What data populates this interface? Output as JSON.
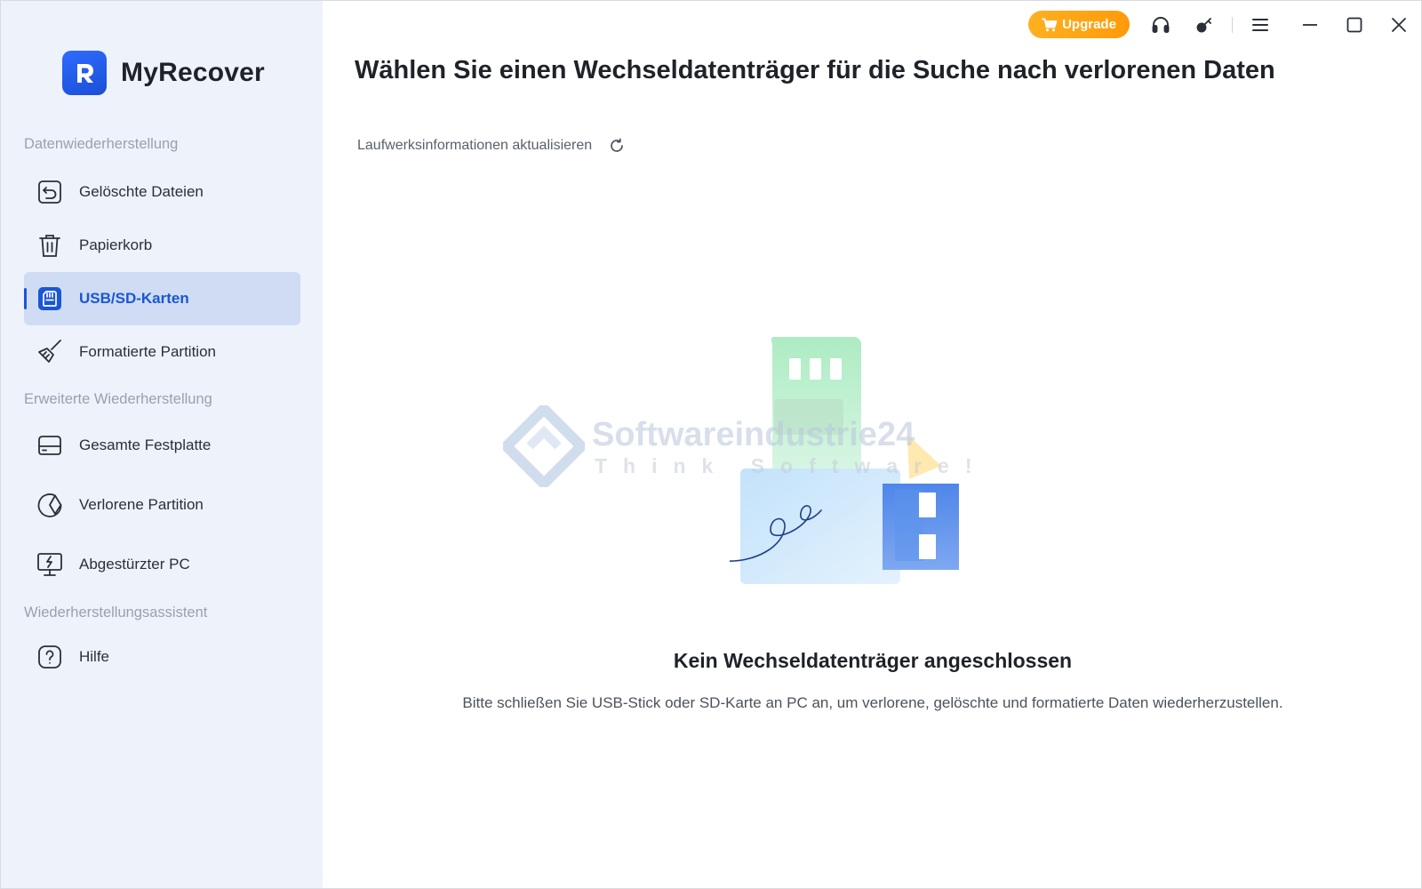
{
  "app": {
    "name": "MyRecover"
  },
  "topbar": {
    "upgrade_label": "Upgrade",
    "icons": [
      "headset-icon",
      "key-icon",
      "menu-icon",
      "minimize-icon",
      "maximize-icon",
      "close-icon"
    ]
  },
  "sidebar": {
    "sections": [
      {
        "label": "Datenwiederherstellung",
        "items": [
          {
            "label": "Gelöschte Dateien",
            "icon": "restore-file-icon"
          },
          {
            "label": "Papierkorb",
            "icon": "trash-icon"
          },
          {
            "label": "USB/SD-Karten",
            "icon": "sd-card-icon",
            "active": true
          },
          {
            "label": "Formatierte Partition",
            "icon": "broom-icon"
          }
        ]
      },
      {
        "label": "Erweiterte Wiederherstellung",
        "items": [
          {
            "label": "Gesamte Festplatte",
            "icon": "hard-drive-icon"
          },
          {
            "label": "Verlorene Partition",
            "icon": "partition-icon"
          },
          {
            "label": "Abgestürzter PC",
            "icon": "crashed-pc-icon"
          }
        ]
      },
      {
        "label": "Wiederherstellungsassistent",
        "items": [
          {
            "label": "Hilfe",
            "icon": "help-icon"
          }
        ]
      }
    ]
  },
  "main": {
    "title": "Wählen Sie einen Wechseldatenträger für die Suche nach verlorenen Daten",
    "refresh_label": "Laufwerksinformationen aktualisieren",
    "empty_title": "Kein Wechseldatenträger angeschlossen",
    "empty_description": "Bitte schließen Sie USB-Stick oder SD-Karte an PC an, um verlorene, gelöschte und formatierte Daten wiederherzustellen."
  },
  "watermark": {
    "line1": "Softwareindustrie24",
    "line2": "Think Software!"
  },
  "colors": {
    "accent": "#1a56d6",
    "sidebar_bg": "#eef2fb",
    "active_bg": "#cfdcf3",
    "upgrade": "#ffa214"
  }
}
